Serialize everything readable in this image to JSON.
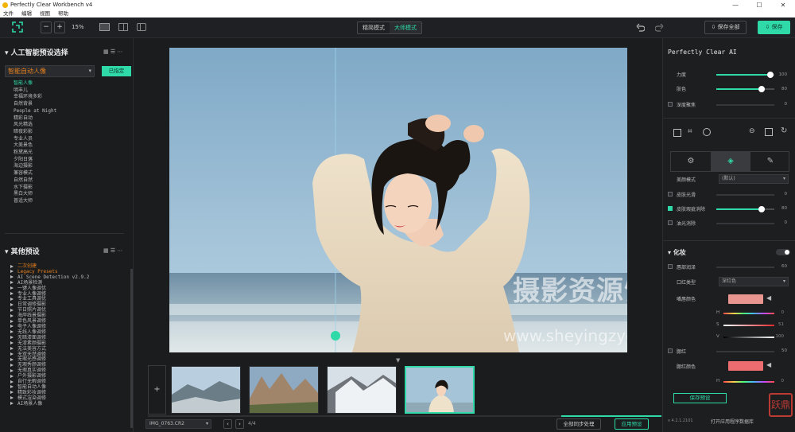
{
  "window": {
    "title": "Perfectly Clear Workbench v4",
    "minimize": "—",
    "maximize": "☐",
    "close": "✕"
  },
  "menu": [
    "文件",
    "编辑",
    "视图",
    "帮助"
  ],
  "toolbar": {
    "zoom_minus": "−",
    "zoom_plus": "+",
    "zoom_level": "15%",
    "mode_precise": "精简模式",
    "mode_big": "大师模式",
    "save_all": "保存全部",
    "save": "保存"
  },
  "left": {
    "ai_header": "人工智能预设选择",
    "dropdown": "智能自动人像",
    "copy_button": "已指定",
    "ai_presets": [
      "智能人像",
      "明丰儿",
      "幸福环境多彩",
      "自然背景",
      "People at Night",
      "精彩自动",
      "风光精选",
      "暗夜彩影",
      "专业人员",
      "大美景色",
      "粉黛高光",
      "夕阳日落",
      "海边摄影",
      "兼容模式",
      "自然自然",
      "水下摄影",
      "黑白大师",
      "普适大师"
    ],
    "other_header": "其他预设",
    "tree": [
      "二次创建",
      "Legacy Presets",
      "AI Scene Detection v2.9.2",
      "AI场景检测",
      "一键人像调优",
      "专业人像调修",
      "专业工具调优",
      "日常调修摄影",
      "节日照片调优",
      "海岸线景摄影",
      "单色风景调修",
      "电子人像调修",
      "无线人像调修",
      "无暗漆面调修",
      "无漆素颜摄影",
      "无法美容方式",
      "无双天然调修",
      "无瑕光感调修",
      "无瑕秀颜调修",
      "无瑕真实调修",
      "户外摄影调修",
      "自行无暇调修",
      "智能自动人像",
      "精致彩妆调修",
      "模式渲染调修",
      "AI场景人像"
    ]
  },
  "bottom": {
    "file_name": "IMG_0763.CR2",
    "page_info": "4/4",
    "batch_button": "全部同步处理",
    "apply_button": "应用预设"
  },
  "right": {
    "title": "Perfectly Clear AI",
    "strength": {
      "label": "力度",
      "value": "100"
    },
    "tone": {
      "label": "肤色",
      "value": "80"
    },
    "depth_label": "深度聚焦",
    "depth_value": "0",
    "beauty_type_label": "美颜模式",
    "beauty_type_value": "(默认)",
    "skin_smooth": {
      "label": "皮肤光滑",
      "value": "0"
    },
    "blemish": {
      "label": "皮肤瑕疵消除",
      "value": "80"
    },
    "shine": {
      "label": "油光消除",
      "value": "0"
    },
    "makeup_header": "化妆",
    "lipstick": {
      "label": "唇部润泽",
      "value": "60"
    },
    "lip_type": {
      "label": "口红类型",
      "value": "深红色"
    },
    "lip_color_label": "嘴唇颜色",
    "lip_hsv": [
      {
        "label": "H",
        "value": "0"
      },
      {
        "label": "S",
        "value": "51"
      },
      {
        "label": "V",
        "value": "100"
      }
    ],
    "blush": {
      "label": "腮红",
      "value": "50"
    },
    "blush_color_label": "腮红颜色",
    "blush_h": {
      "label": "H",
      "value": "0"
    },
    "save_preset": "保存预设",
    "version": "v 4.2.1.2101",
    "open_folder": "打开应用程序数据库"
  },
  "watermark": {
    "cn": "摄影资源馆",
    "url": "www.sheyingzyg.com",
    "badge": "跃鼎"
  },
  "colors": {
    "accent": "#2fd9a8",
    "lip": "#e7958e",
    "blush": "#ec6c70",
    "preset_active": "#2fd9a8",
    "tree_highlight": "#e6811e"
  }
}
